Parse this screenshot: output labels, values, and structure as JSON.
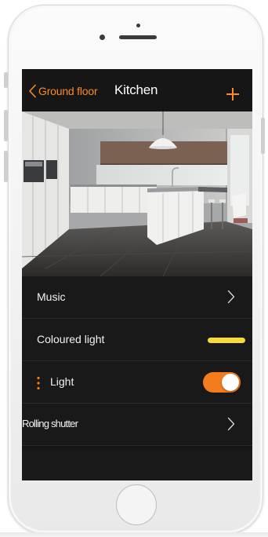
{
  "nav": {
    "back_label": "Ground floor",
    "title": "Kitchen",
    "add_icon": "plus-icon",
    "back_icon": "chevron-left-icon"
  },
  "room_image": {
    "subject": "kitchen-photo"
  },
  "rows": [
    {
      "label": "Music",
      "control": "chevron-right-icon"
    },
    {
      "label": "Coloured light",
      "control": "colour-indicator",
      "color": "#f7d93a"
    },
    {
      "label": "Light",
      "control": "toggle",
      "toggle_on": true,
      "accent": "#f47c1c"
    },
    {
      "label": "Rolling shutter",
      "control": "chevron-right-icon"
    }
  ],
  "colors": {
    "accent": "#ff8a1e",
    "screen_background": "#161616",
    "row_background": "#191919",
    "row_divider": "#2a2a2a",
    "text": "#f2f2f2"
  }
}
